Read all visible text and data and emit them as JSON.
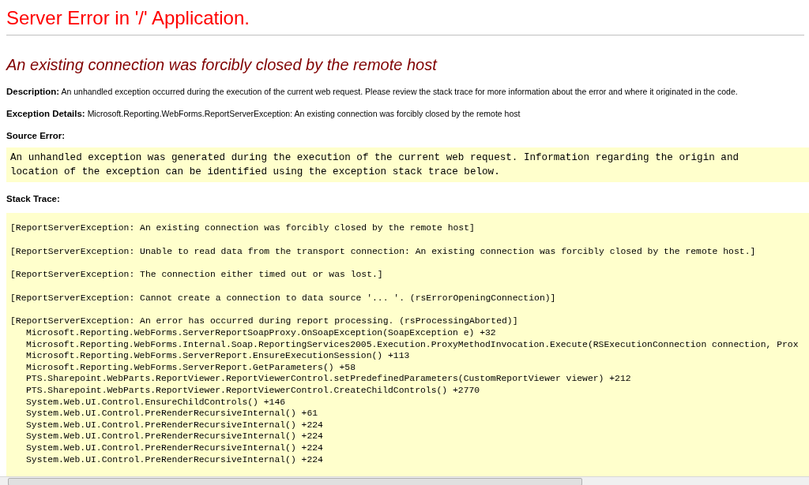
{
  "title": "Server Error in '/' Application.",
  "error_heading": "An existing connection was forcibly closed by the remote host",
  "fields": [
    {
      "label": "Description:",
      "text": "An unhandled exception occurred during the execution of the current web request. Please review the stack trace for more information about the error and where it originated in the code."
    },
    {
      "label": "Exception Details:",
      "text": "Microsoft.Reporting.WebForms.ReportServerException: An existing connection was forcibly closed by the remote host"
    }
  ],
  "source_error": {
    "label": "Source Error:",
    "lines": [
      "An unhandled exception was generated during the execution of the current web request. Information regarding the origin and",
      "location of the exception can be identified using the exception stack trace below."
    ]
  },
  "stack_trace": {
    "label": "Stack Trace:",
    "exceptions": [
      {
        "message": "[ReportServerException: An existing connection was forcibly closed by the remote host]"
      },
      {
        "message": "[ReportServerException: Unable to read data from the transport connection: An existing connection was forcibly closed by the remote host.]"
      },
      {
        "message": "[ReportServerException: The connection either timed out or was lost.]"
      },
      {
        "message": "[ReportServerException: Cannot create a connection to data source '... '. (rsErrorOpeningConnection)]"
      },
      {
        "message": "[ReportServerException: An error has occurred during report processing. (rsProcessingAborted)]",
        "frames": [
          "Microsoft.Reporting.WebForms.ServerReportSoapProxy.OnSoapException(SoapException e) +32",
          "Microsoft.Reporting.WebForms.Internal.Soap.ReportingServices2005.Execution.ProxyMethodInvocation.Execute(RSExecutionConnection connection, Prox",
          "Microsoft.Reporting.WebForms.ServerReport.EnsureExecutionSession() +113",
          "Microsoft.Reporting.WebForms.ServerReport.GetParameters() +58",
          "PTS.Sharepoint.WebParts.ReportViewer.ReportViewerControl.setPredefinedParameters(CustomReportViewer viewer) +212",
          "PTS.Sharepoint.WebParts.ReportViewer.ReportViewerControl.CreateChildControls() +2770",
          "System.Web.UI.Control.EnsureChildControls() +146",
          "System.Web.UI.Control.PreRenderRecursiveInternal() +61",
          "System.Web.UI.Control.PreRenderRecursiveInternal() +224",
          "System.Web.UI.Control.PreRenderRecursiveInternal() +224",
          "System.Web.UI.Control.PreRenderRecursiveInternal() +224",
          "System.Web.UI.Control.PreRenderRecursiveInternal() +224"
        ]
      }
    ]
  }
}
